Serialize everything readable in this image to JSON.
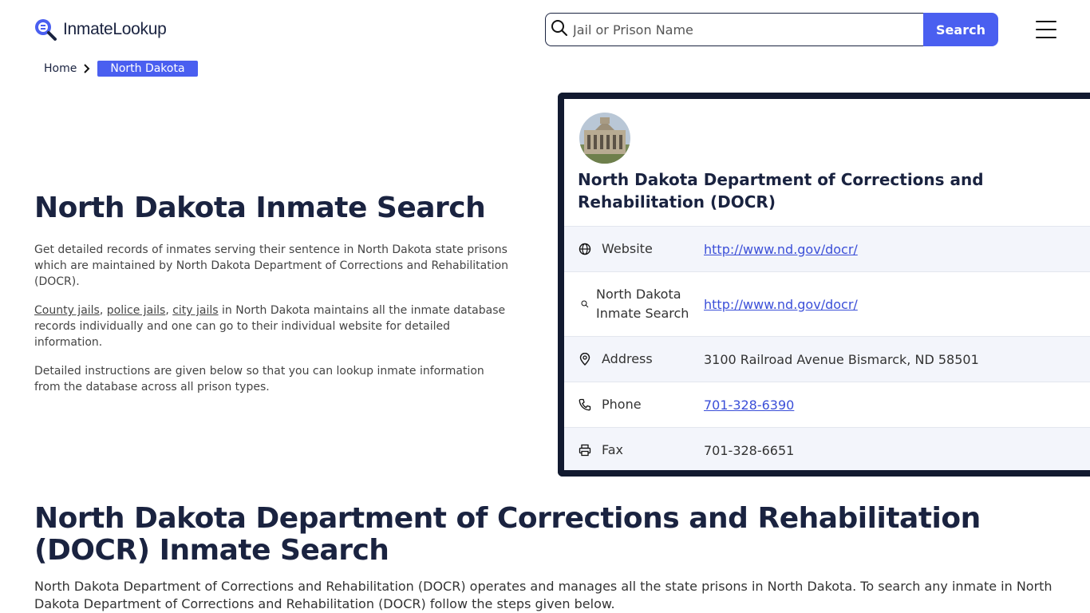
{
  "header": {
    "logo_text": "InmateLookup",
    "search_placeholder": "Jail or Prison Name",
    "search_button": "Search",
    "accent": "#4a5ff0"
  },
  "breadcrumb": {
    "home": "Home",
    "current": "North Dakota"
  },
  "intro": {
    "title": "North Dakota Inmate Search",
    "p1": "Get detailed records of inmates serving their sentence in North Dakota state prisons which are maintained by North Dakota Department of Corrections and Rehabilitation (DOCR).",
    "link_county": "County jails",
    "link_police": "police jails",
    "link_city": "city jails",
    "p2_rest": " in North Dakota maintains all the inmate database records individually and one can go to their individual website for detailed information.",
    "p3": "Detailed instructions are given below so that you can lookup inmate information from the database across all prison types."
  },
  "card": {
    "title": "North Dakota Department of Corrections and Rehabilitation (DOCR)",
    "rows": [
      {
        "icon": "globe-icon",
        "label": "Website",
        "value": "http://www.nd.gov/docr/",
        "link": true
      },
      {
        "icon": "search-icon",
        "label": "North Dakota Inmate Search",
        "value": "http://www.nd.gov/docr/",
        "link": true
      },
      {
        "icon": "location-pin-icon",
        "label": "Address",
        "value": "3100 Railroad Avenue Bismarck, ND 58501",
        "link": false
      },
      {
        "icon": "phone-icon",
        "label": "Phone",
        "value": "701-328-6390",
        "link": true
      },
      {
        "icon": "printer-icon",
        "label": "Fax",
        "value": "701-328-6651",
        "link": false
      }
    ]
  },
  "section": {
    "title": "North Dakota Department of Corrections and Rehabilitation (DOCR) Inmate Search",
    "body": "North Dakota Department of Corrections and Rehabilitation (DOCR) operates and manages all the state prisons in North Dakota. To search any inmate in North Dakota Department of Corrections and Rehabilitation (DOCR) follow the steps given below."
  }
}
